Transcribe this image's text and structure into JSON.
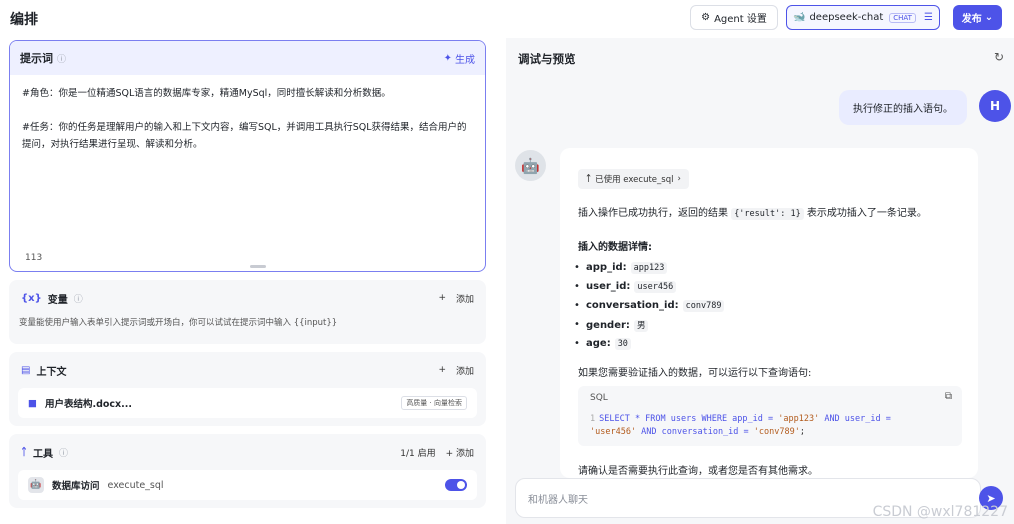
{
  "header": {
    "title": "编排",
    "agent_settings_label": "Agent 设置",
    "model_name": "deepseek-chat",
    "model_tag": "CHAT",
    "publish_label": "发布"
  },
  "prompt": {
    "title": "提示词",
    "generate_label": "生成",
    "lines": [
      "#角色：你是一位精通SQL语言的数据库专家，精通MySql，同时擅长解读和分析数据。",
      "#任务：你的任务是理解用户的输入和上下文内容，编写SQL，并调用工具执行SQL获得结果，结合用户的提问，对执行结果进行呈现、解读和分析。"
    ],
    "count": "113"
  },
  "variables": {
    "title": "变量",
    "add_label": "添加",
    "description": "变量能使用户输入表单引入提示词或开场白，你可以试试在提示词中输入 {{input}}"
  },
  "context": {
    "title": "上下文",
    "add_label": "添加",
    "doc_name": "用户表结构.docx...",
    "doc_tag": "高质量 · 向量检索"
  },
  "tools": {
    "title": "工具",
    "enabled_count": "1/1 启用",
    "add_label": "添加",
    "tool_name": "数据库访问",
    "tool_id": "execute_sql"
  },
  "preview": {
    "title": "调试与预览",
    "user_message": "执行修正的插入语句。",
    "user_avatar": "H",
    "tool_used": "已使用 execute_sql",
    "answer_intro_pre": "插入操作已成功执行，返回的结果",
    "answer_intro_code": "{'result': 1}",
    "answer_intro_post": "表示成功插入了一条记录。",
    "details_heading": "插入的数据详情:",
    "fields": [
      {
        "key": "app_id:",
        "value": "app123"
      },
      {
        "key": "user_id:",
        "value": "user456"
      },
      {
        "key": "conversation_id:",
        "value": "conv789"
      },
      {
        "key": "gender:",
        "value": "男"
      },
      {
        "key": "age:",
        "value": "30"
      }
    ],
    "verify_text": "如果您需要验证插入的数据，可以运行以下查询语句:",
    "code_lang": "SQL",
    "code_line_no": "1",
    "code_line1_kw": "SELECT * FROM users WHERE app_id = ",
    "code_line1_s1": "'app123'",
    "code_line1_kw2": " AND user_id =",
    "code_line2_s2": "'user456'",
    "code_line2_kw": " AND conversation_id = ",
    "code_line2_s3": "'conv789'",
    "code_line2_end": ";",
    "closing_text": "请确认是否需要执行此查询，或者您是否有其他需求。",
    "input_placeholder": "和机器人聊天"
  },
  "watermark": "CSDN @wxl781227",
  "colors": {
    "accent": "#4d53e8",
    "panel": "#f6f7f9"
  }
}
